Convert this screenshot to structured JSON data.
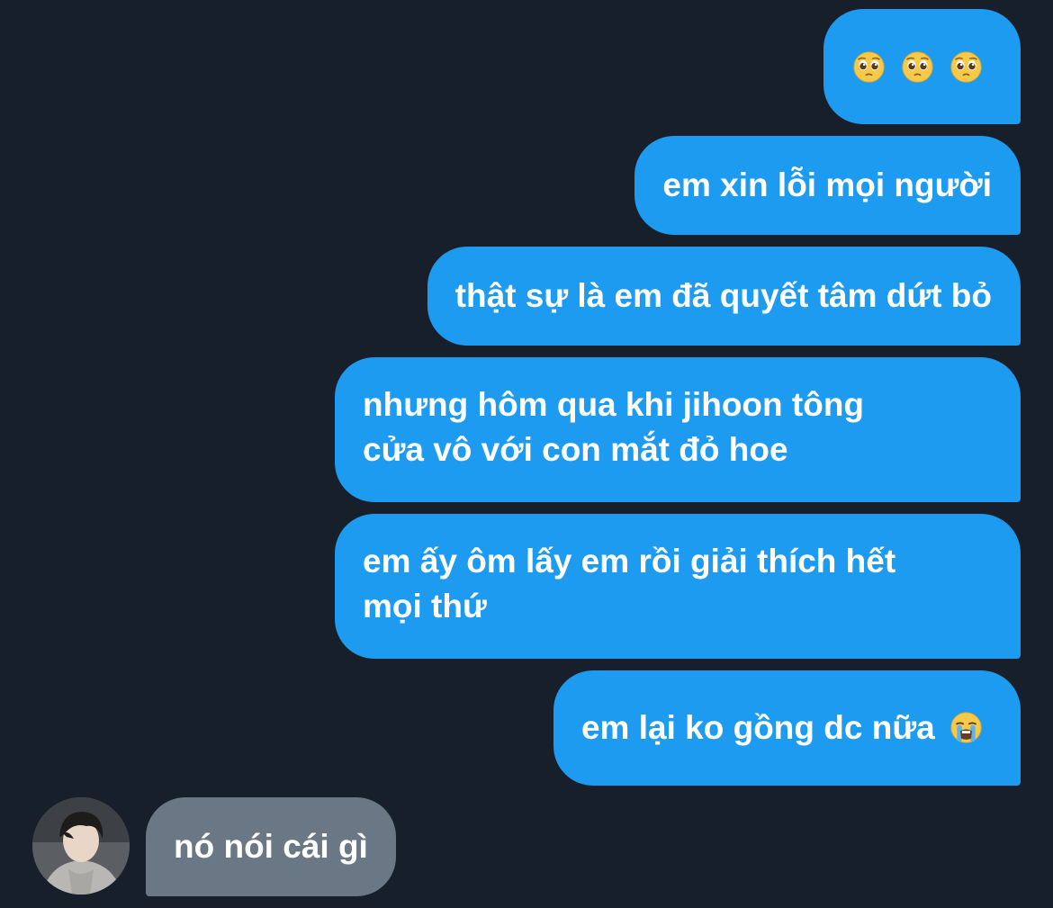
{
  "messages": [
    {
      "from": "me",
      "emojis": [
        "pleading-face",
        "pleading-face",
        "pleading-face"
      ]
    },
    {
      "from": "me",
      "text": "em xin lỗi mọi người"
    },
    {
      "from": "me",
      "text": "thật sự là em đã quyết tâm dứt bỏ"
    },
    {
      "from": "me",
      "lines": [
        "nhưng hôm qua khi jihoon tông",
        "cửa vô với con mắt đỏ hoe"
      ]
    },
    {
      "from": "me",
      "lines": [
        "em ấy ôm lấy em rồi giải thích hết",
        "mọi thứ"
      ]
    },
    {
      "from": "me",
      "text": "em lại ko gồng dc nữa",
      "emoji": "loudly-crying-face"
    },
    {
      "from": "other",
      "text": "nó nói cái gì"
    }
  ],
  "colors": {
    "background": "#17202a",
    "outgoing_bubble": "#1d9bf0",
    "incoming_bubble": "#6a7886",
    "text": "#ffffff"
  }
}
